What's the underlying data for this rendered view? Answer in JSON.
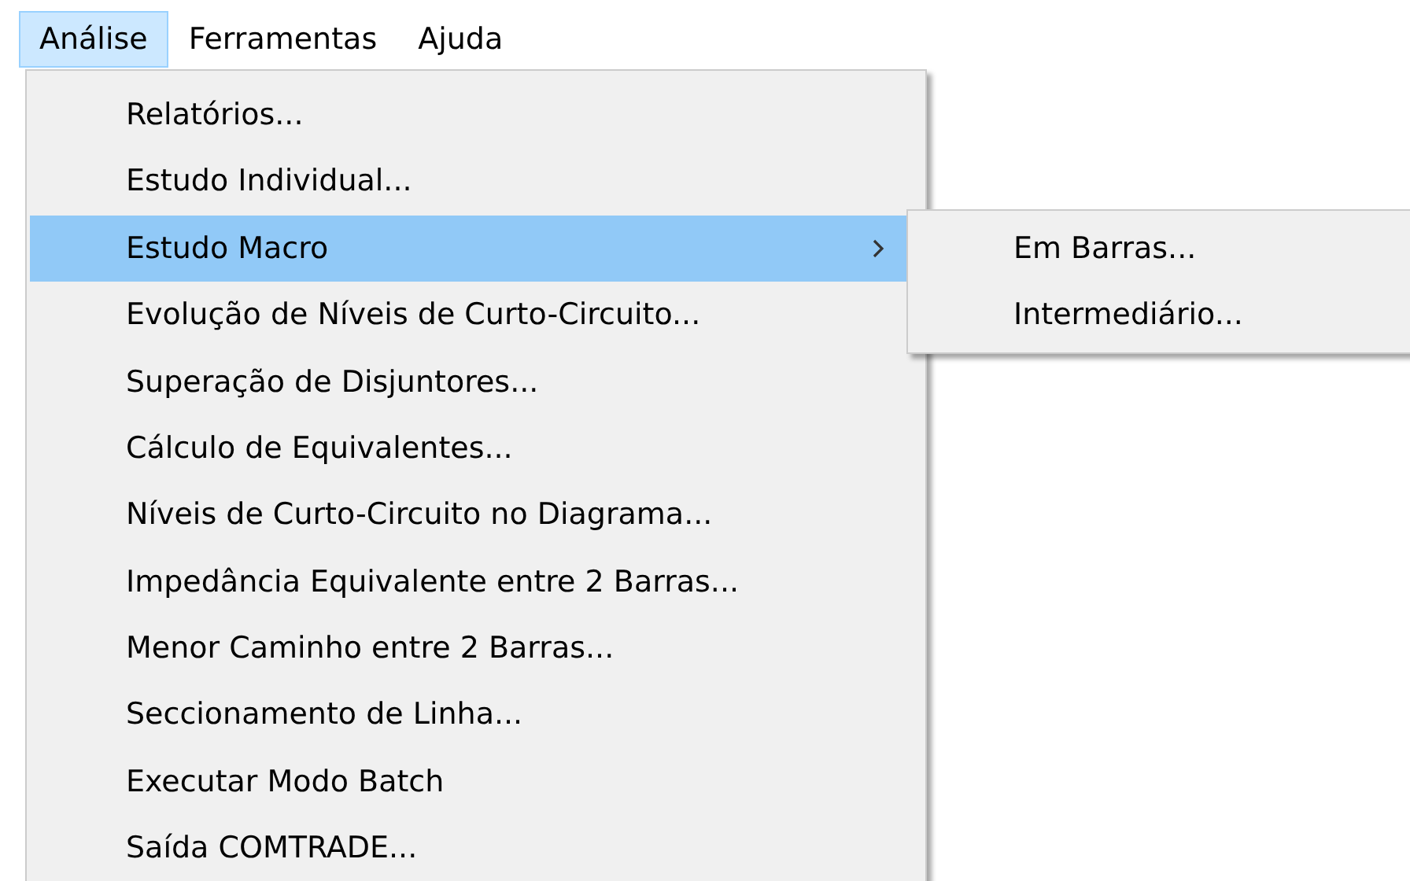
{
  "menubar": [
    {
      "label": "Análise",
      "selected": true
    },
    {
      "label": "Ferramentas",
      "selected": false
    },
    {
      "label": "Ajuda",
      "selected": false
    }
  ],
  "menu": {
    "items": [
      {
        "label": "Relatórios...",
        "selected": false,
        "submenu": false
      },
      {
        "label": "Estudo Individual...",
        "selected": false,
        "submenu": false
      },
      {
        "label": "Estudo Macro",
        "selected": true,
        "submenu": true
      },
      {
        "label": "Evolução de Níveis de Curto-Circuito...",
        "selected": false,
        "submenu": false
      },
      {
        "label": "Superação de Disjuntores...",
        "selected": false,
        "submenu": false
      },
      {
        "label": "Cálculo de Equivalentes...",
        "selected": false,
        "submenu": false
      },
      {
        "label": "Níveis de Curto-Circuito no Diagrama...",
        "selected": false,
        "submenu": false
      },
      {
        "label": "Impedância Equivalente entre 2 Barras...",
        "selected": false,
        "submenu": false
      },
      {
        "label": "Menor Caminho entre 2 Barras...",
        "selected": false,
        "submenu": false
      },
      {
        "label": "Seccionamento de Linha...",
        "selected": false,
        "submenu": false
      },
      {
        "label": "Executar Modo Batch",
        "selected": false,
        "submenu": false
      },
      {
        "label": "Saída COMTRADE...",
        "selected": false,
        "submenu": false
      }
    ]
  },
  "submenu": {
    "items": [
      {
        "label": "Em Barras..."
      },
      {
        "label": "Intermediário..."
      }
    ]
  }
}
